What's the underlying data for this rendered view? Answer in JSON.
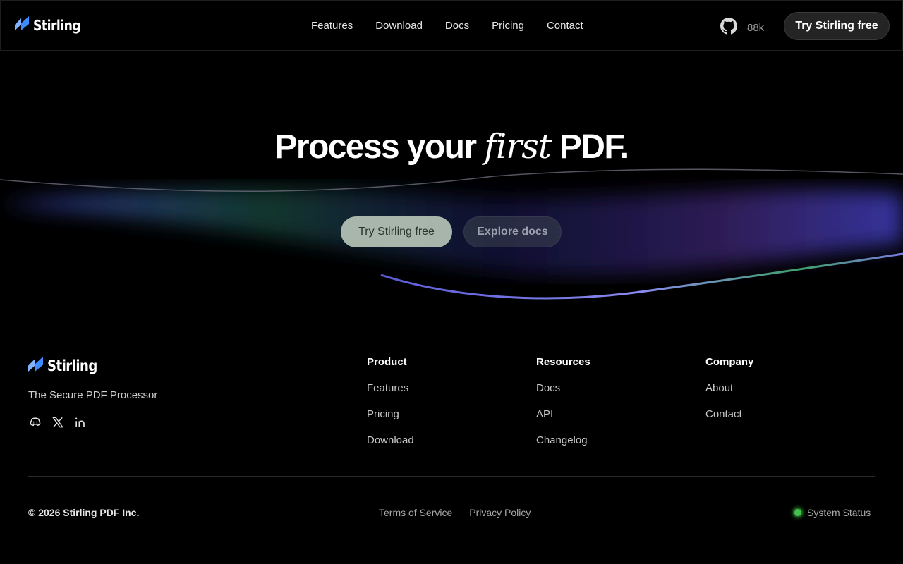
{
  "brand": {
    "name": "Stirling"
  },
  "nav": {
    "items": [
      "Features",
      "Download",
      "Docs",
      "Pricing",
      "Contact"
    ]
  },
  "github": {
    "stars": "88k"
  },
  "header": {
    "cta_label": "Try Stirling free"
  },
  "hero": {
    "title_before": "Process your ",
    "title_accent": "first",
    "title_after": " PDF.",
    "primary_label": "Try Stirling free",
    "secondary_label": "Explore docs"
  },
  "footer": {
    "tagline": "The Secure PDF Processor",
    "columns": [
      {
        "heading": "Product",
        "links": [
          "Features",
          "Pricing",
          "Download"
        ]
      },
      {
        "heading": "Resources",
        "links": [
          "Docs",
          "API",
          "Changelog"
        ]
      },
      {
        "heading": "Company",
        "links": [
          "About",
          "Contact"
        ]
      }
    ],
    "copyright": "© 2026 Stirling PDF Inc.",
    "legal": [
      "Terms of Service",
      "Privacy Policy"
    ],
    "status_label": "System Status"
  },
  "colors": {
    "background": "#000000",
    "status_ok": "#45c04e",
    "logo_blue": "#3d8bff"
  },
  "icons": [
    "logo-icon",
    "github-icon",
    "discord-icon",
    "x-icon",
    "linkedin-icon"
  ]
}
